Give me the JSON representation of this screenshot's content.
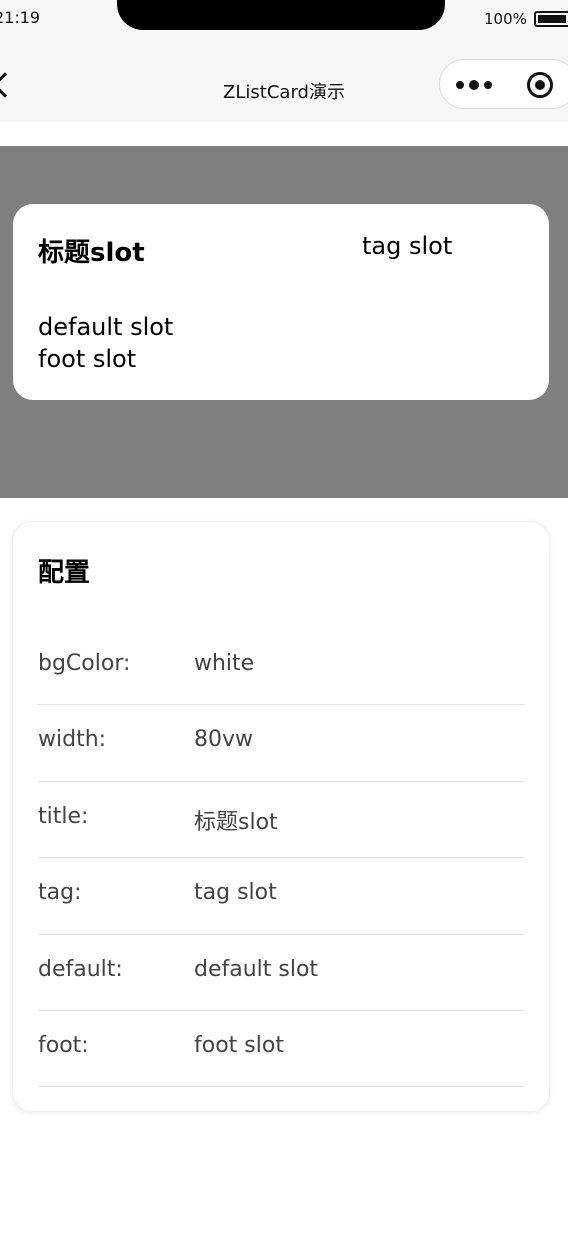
{
  "status_bar": {
    "time": "21:19",
    "battery": "100%"
  },
  "nav": {
    "title": "ZListCard演示",
    "back_icon": "chevron-left-icon",
    "more_icon": "more-dots-icon",
    "target_icon": "target-icon"
  },
  "demo": {
    "background_color": "#808080",
    "card_background": "white",
    "title": "标题slot",
    "tag": "tag slot",
    "default": "default slot",
    "foot": "foot slot"
  },
  "config": {
    "title": "配置",
    "rows": [
      {
        "key": "bgColor:",
        "value": "white"
      },
      {
        "key": "width:",
        "value": "80vw"
      },
      {
        "key": "title:",
        "value": "标题slot"
      },
      {
        "key": "tag:",
        "value": "tag slot"
      },
      {
        "key": "default:",
        "value": "default slot"
      },
      {
        "key": "foot:",
        "value": "foot slot"
      }
    ]
  }
}
